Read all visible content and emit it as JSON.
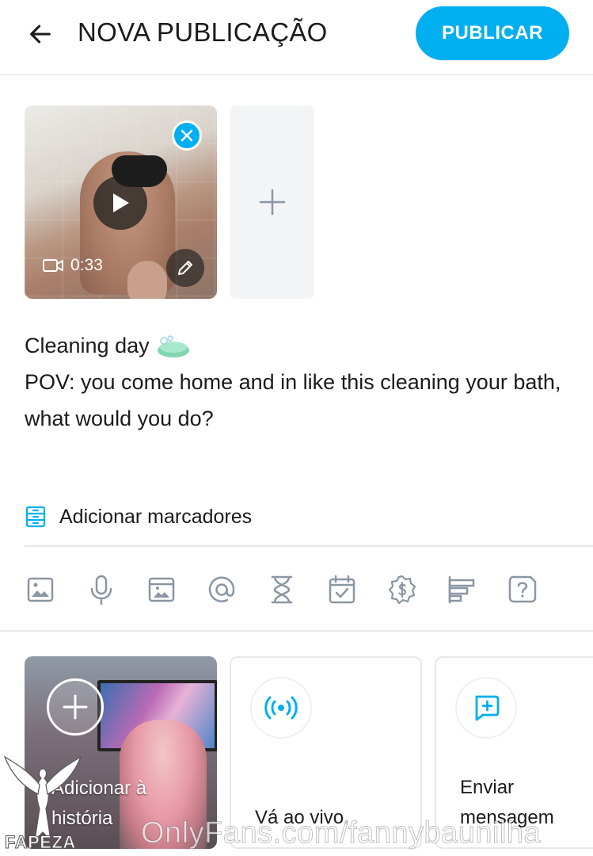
{
  "header": {
    "title": "NOVA PUBLICAÇÃO",
    "publish_label": "PUBLICAR"
  },
  "media": {
    "duration": "0:33"
  },
  "post": {
    "line1": "Cleaning day",
    "line2": "POV: you come home and in like this cleaning your bath, what would you do?"
  },
  "tags": {
    "label": "Adicionar marcadores"
  },
  "toolbar": {
    "icons": [
      "image-icon",
      "microphone-icon",
      "vault-icon",
      "mention-icon",
      "hourglass-icon",
      "calendar-check-icon",
      "price-tag-icon",
      "poll-icon",
      "quiz-icon"
    ]
  },
  "cards": {
    "story_label": "Adicionar à história",
    "live_label": "Vá ao vivo.",
    "message_label": "Enviar mensagem"
  },
  "watermark": {
    "url": "OnlyFans.com/fannybaunilha",
    "logo_text": "FAPEZA"
  },
  "colors": {
    "accent": "#00aff0",
    "icon_gray": "#8a96a3",
    "divider": "#e6e8eb"
  }
}
